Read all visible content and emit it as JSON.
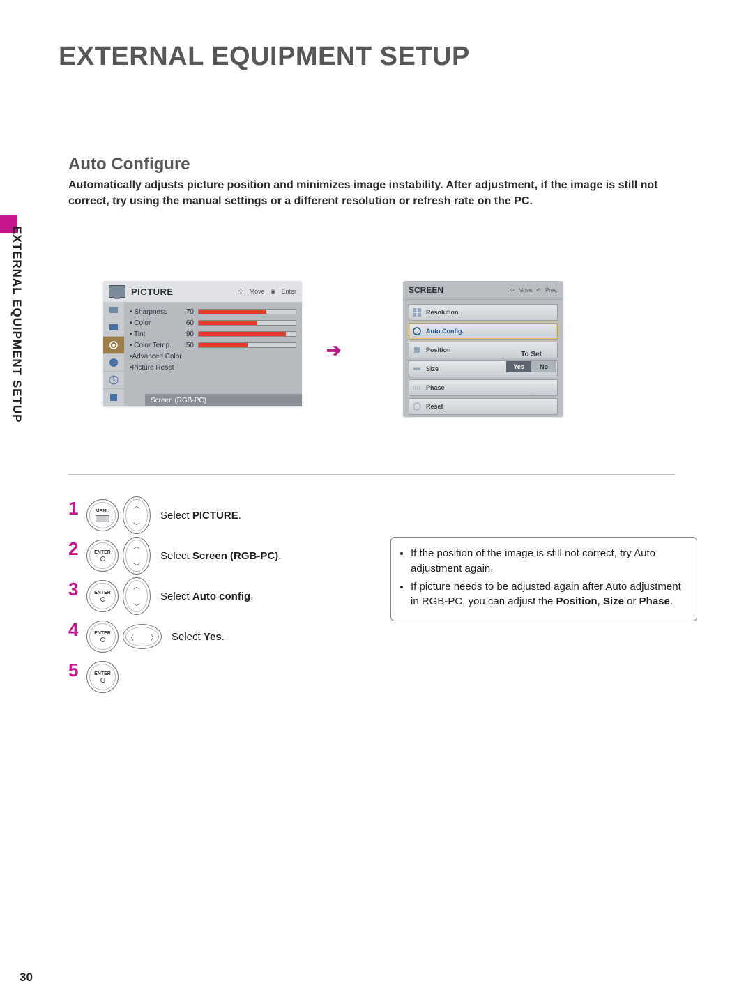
{
  "side_label": "EXTERNAL EQUIPMENT SETUP",
  "title": "EXTERNAL EQUIPMENT SETUP",
  "section_title": "Auto Configure",
  "intro": "Automatically adjusts picture position and minimizes image instability. After adjustment, if the image is still not correct, try using the manual settings or a different resolution or refresh rate on the PC.",
  "panel1": {
    "title": "PICTURE",
    "hints": {
      "move": "Move",
      "enter": "Enter"
    },
    "rows": [
      {
        "label": "Sharpness",
        "value": "70",
        "pct": 70
      },
      {
        "label": "Color",
        "value": "60",
        "pct": 60
      },
      {
        "label": "Tint",
        "value": "90",
        "pct": 90
      },
      {
        "label": "Color Temp.",
        "value": "50",
        "pct": 50
      }
    ],
    "links": [
      "Advanced Color",
      "Picture Reset"
    ],
    "selected": "Screen (RGB-PC)"
  },
  "panel2": {
    "title": "SCREEN",
    "hints": {
      "move": "Move",
      "prev": "Prev."
    },
    "items": [
      "Resolution",
      "Auto Config.",
      "Position",
      "Size",
      "Phase",
      "Reset"
    ],
    "selected_index": 1,
    "to_set": "To Set",
    "yes": "Yes",
    "no": "No"
  },
  "steps": [
    {
      "n": "1",
      "btn": "MENU",
      "dir": "v",
      "pre": "Select ",
      "bold": "PICTURE",
      "post": "."
    },
    {
      "n": "2",
      "btn": "ENTER",
      "dir": "v",
      "pre": "Select ",
      "bold": "Screen (RGB-PC)",
      "post": "."
    },
    {
      "n": "3",
      "btn": "ENTER",
      "dir": "v",
      "pre": "Select ",
      "bold": "Auto config",
      "post": "."
    },
    {
      "n": "4",
      "btn": "ENTER",
      "dir": "h",
      "pre": "Select ",
      "bold": "Yes",
      "post": "."
    },
    {
      "n": "5",
      "btn": "ENTER",
      "dir": "",
      "pre": "",
      "bold": "",
      "post": ""
    }
  ],
  "note": {
    "l1a": "If the position of the image is still not correct, try Auto adjustment again.",
    "l2a": "If picture needs to be adjusted again after Auto adjustment in RGB-PC, you can adjust the ",
    "l2b": "Position",
    "l2c": ", ",
    "l2d": "Size",
    "l2e": " or ",
    "l2f": "Phase",
    "l2g": "."
  },
  "page_number": "30"
}
